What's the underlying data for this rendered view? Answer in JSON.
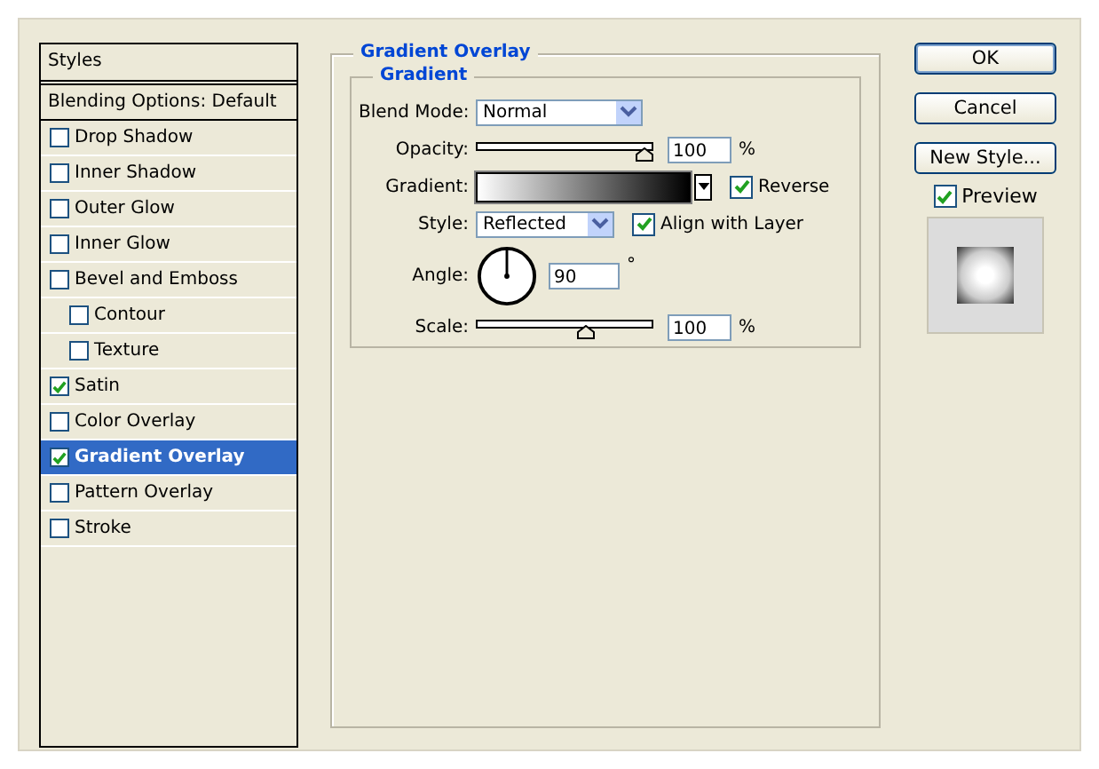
{
  "sidebar": {
    "title": "Styles",
    "blending": "Blending Options: Default",
    "items": [
      {
        "label": "Drop Shadow",
        "checked": false,
        "selected": false
      },
      {
        "label": "Inner Shadow",
        "checked": false,
        "selected": false
      },
      {
        "label": "Outer Glow",
        "checked": false,
        "selected": false
      },
      {
        "label": "Inner Glow",
        "checked": false,
        "selected": false
      },
      {
        "label": "Bevel and Emboss",
        "checked": false,
        "selected": false,
        "children": [
          {
            "label": "Contour",
            "checked": false,
            "selected": false
          },
          {
            "label": "Texture",
            "checked": false,
            "selected": false
          }
        ]
      },
      {
        "label": "Satin",
        "checked": true,
        "selected": false
      },
      {
        "label": "Color Overlay",
        "checked": false,
        "selected": false
      },
      {
        "label": "Gradient Overlay",
        "checked": true,
        "selected": true
      },
      {
        "label": "Pattern Overlay",
        "checked": false,
        "selected": false
      },
      {
        "label": "Stroke",
        "checked": false,
        "selected": false
      }
    ]
  },
  "panel": {
    "title": "Gradient Overlay",
    "group": "Gradient",
    "blend_mode": {
      "label": "Blend Mode:",
      "value": "Normal"
    },
    "opacity": {
      "label": "Opacity:",
      "level": 1,
      "value": "100",
      "unit": "%"
    },
    "gradient": {
      "label": "Gradient:",
      "reverse": {
        "label": "Reverse",
        "checked": true
      }
    },
    "style": {
      "label": "Style:",
      "value": "Reflected",
      "align": {
        "label": "Align with Layer",
        "checked": true
      }
    },
    "angle": {
      "label": "Angle:",
      "value": "90",
      "unit": "°"
    },
    "scale": {
      "label": "Scale:",
      "level": 0.63,
      "value": "100",
      "unit": "%"
    }
  },
  "buttons": [
    {
      "label": "OK",
      "default": true
    },
    {
      "label": "Cancel",
      "default": false
    },
    {
      "label": "New Style...",
      "default": false
    }
  ],
  "preview": {
    "label": "Preview",
    "checked": true
  }
}
